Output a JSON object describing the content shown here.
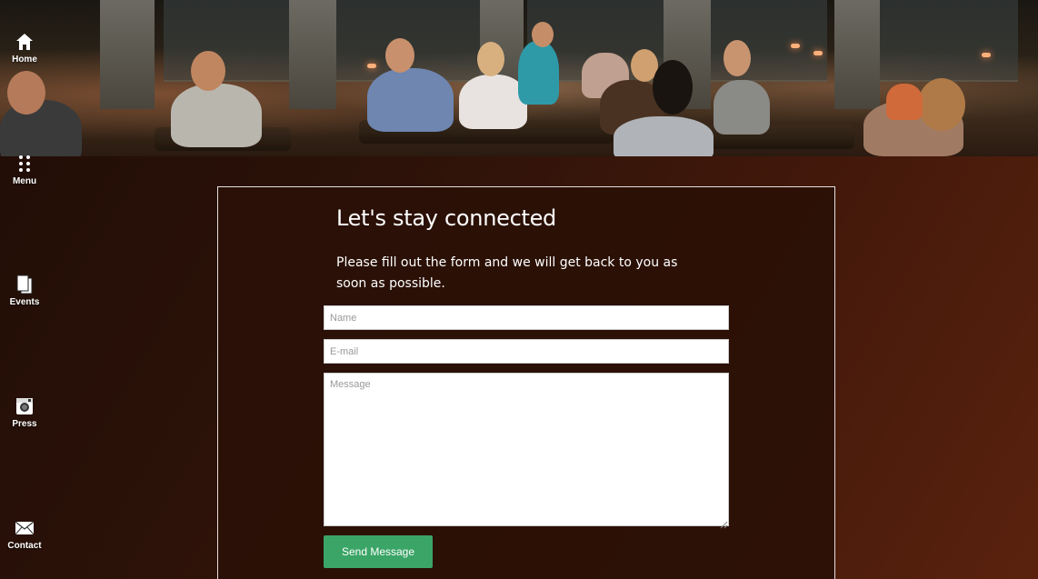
{
  "nav": {
    "items": [
      {
        "label": "Home",
        "icon": "home-icon"
      },
      {
        "label": "Menu",
        "icon": "dots-icon"
      },
      {
        "label": "Events",
        "icon": "documents-icon"
      },
      {
        "label": "Press",
        "icon": "camera-icon"
      },
      {
        "label": "Contact",
        "icon": "envelope-icon"
      }
    ]
  },
  "hero": {
    "image": "restaurant-dining-photo"
  },
  "contact": {
    "title": "Let's stay connected",
    "subtitle": "Please fill out the form and we will get back to you as soon as possible.",
    "name_placeholder": "Name",
    "email_placeholder": "E-mail",
    "message_placeholder": "Message",
    "send_label": "Send Message"
  },
  "colors": {
    "accent": "#3aa566",
    "panel_bg": "#2a1006",
    "page_bg_dark": "#1f0d06",
    "page_bg_light": "#5a220e"
  }
}
